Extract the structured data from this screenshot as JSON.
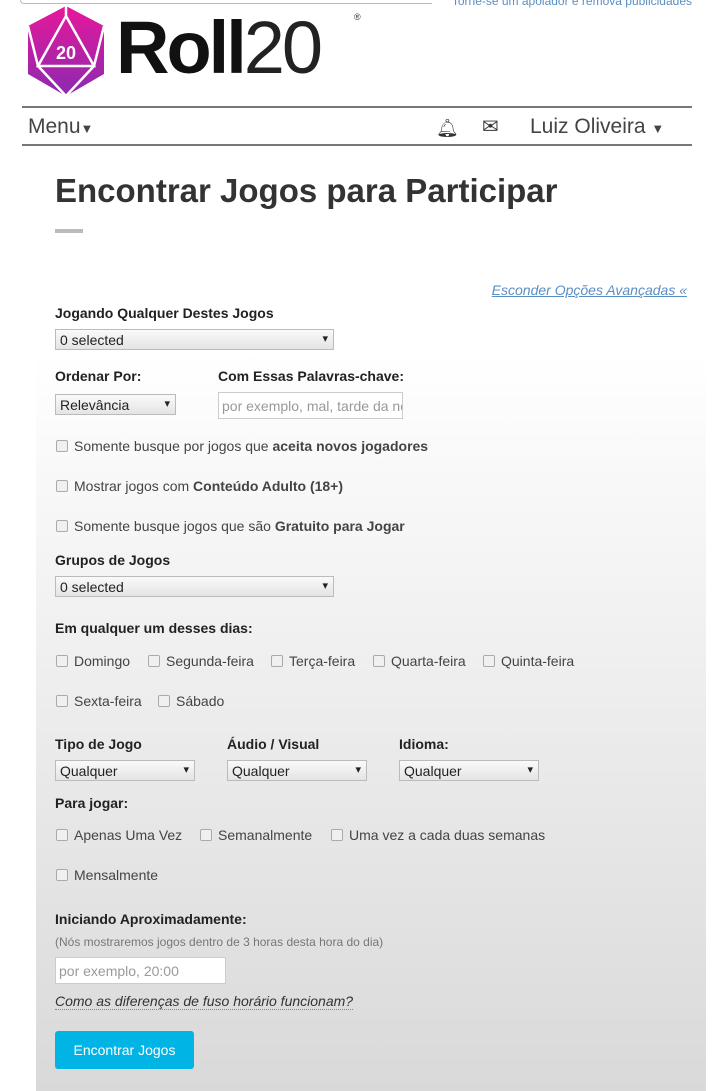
{
  "promo": "Torne-se um apoiador e remova publicidades",
  "brand": {
    "bold": "Roll",
    "light": "20",
    "die": "20"
  },
  "nav": {
    "menu": "Menu",
    "user": "Luiz Oliveira"
  },
  "title": "Encontrar Jogos para Participar",
  "hide_advanced": "Esconder Opções Avançadas «",
  "games_label": "Jogando Qualquer Destes Jogos",
  "games_value": "0 selected",
  "order_label": "Ordenar Por:",
  "order_value": "Relevância",
  "keywords_label": "Com Essas Palavras-chave:",
  "keywords_placeholder": "por exemplo, mal, tarde da noite",
  "checks": [
    {
      "pre": "Somente busque por jogos que ",
      "bold": "aceita novos jogadores"
    },
    {
      "pre": "Mostrar jogos com ",
      "bold": "Conteúdo Adulto (18+)"
    },
    {
      "pre": "Somente busque jogos que são ",
      "bold": "Gratuito para Jogar"
    }
  ],
  "groups_label": "Grupos de Jogos",
  "groups_value": "0 selected",
  "days_label": "Em qualquer um desses dias:",
  "days": [
    "Domingo",
    "Segunda-feira",
    "Terça-feira",
    "Quarta-feira",
    "Quinta-feira",
    "Sexta-feira",
    "Sábado"
  ],
  "type_label": "Tipo de Jogo",
  "type_value": "Qualquer",
  "av_label": "Áudio / Visual",
  "av_value": "Qualquer",
  "lang_label": "Idioma:",
  "lang_value": "Qualquer",
  "freq_label": "Para jogar:",
  "freq": [
    "Apenas Uma Vez",
    "Semanalmente",
    "Uma vez a cada duas semanas",
    "Mensalmente"
  ],
  "start_label": "Iniciando Aproximadamente:",
  "start_note": "(Nós mostraremos jogos dentro de 3 horas desta hora do dia)",
  "start_placeholder": "por exemplo, 20:00",
  "tz_link": "Como as diferenças de fuso horário funcionam?",
  "submit": "Encontrar Jogos",
  "colors": {
    "accent": "#00b5e6",
    "link": "#5a8fc4",
    "logo": "#e0198a"
  }
}
